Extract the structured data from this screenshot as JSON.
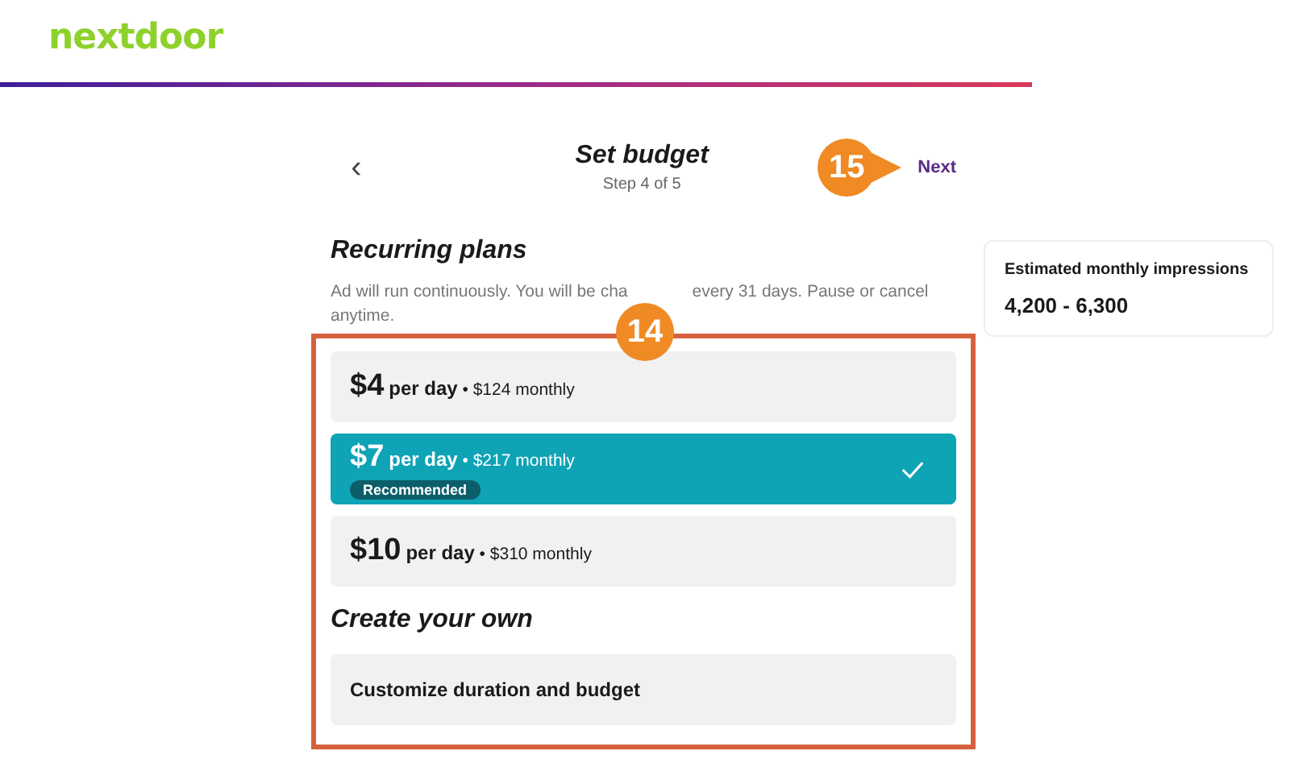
{
  "brand": {
    "logo": "nextdoor"
  },
  "header": {
    "back": "‹",
    "title": "Set budget",
    "step": "Step 4 of 5",
    "next": "Next"
  },
  "recurring": {
    "heading": "Recurring plans",
    "description_before": "Ad will run continuously. You will be cha",
    "description_after": "every 31 days. Pause or cancel",
    "description_end": "anytime.",
    "plans": [
      {
        "amount": "$4",
        "unit": "per day",
        "monthly": "• $124 monthly",
        "selected": false
      },
      {
        "amount": "$7",
        "unit": "per day",
        "monthly": "• $217 monthly",
        "badge": "Recommended",
        "selected": true
      },
      {
        "amount": "$10",
        "unit": "per day",
        "monthly": "• $310 monthly",
        "selected": false
      }
    ]
  },
  "custom": {
    "heading": "Create your own",
    "option": "Customize duration and budget"
  },
  "estimate": {
    "label": "Estimated monthly impressions",
    "value": "4,200 - 6,300"
  },
  "annotations": [
    {
      "kind": "frame",
      "number": "14"
    },
    {
      "kind": "pointer",
      "number": "15"
    }
  ]
}
